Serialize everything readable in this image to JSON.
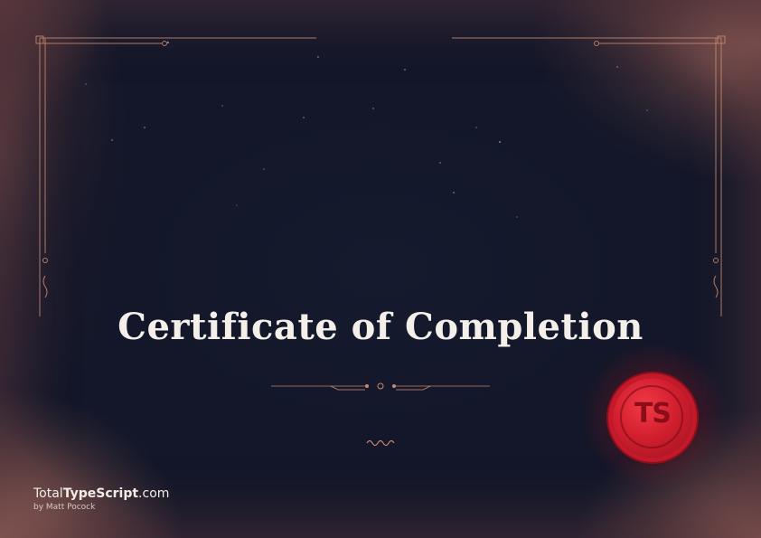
{
  "certificate": {
    "title": "Certificate of Completion"
  },
  "seal": {
    "text": "TS",
    "color": "#d21f2e"
  },
  "brand": {
    "prefix": "Total",
    "bold": "TypeScript",
    "suffix": ".com",
    "byline": "by Matt Pocock"
  },
  "colors": {
    "background": "#131729",
    "frame": "#c98a6e",
    "title": "#f4efe9"
  }
}
